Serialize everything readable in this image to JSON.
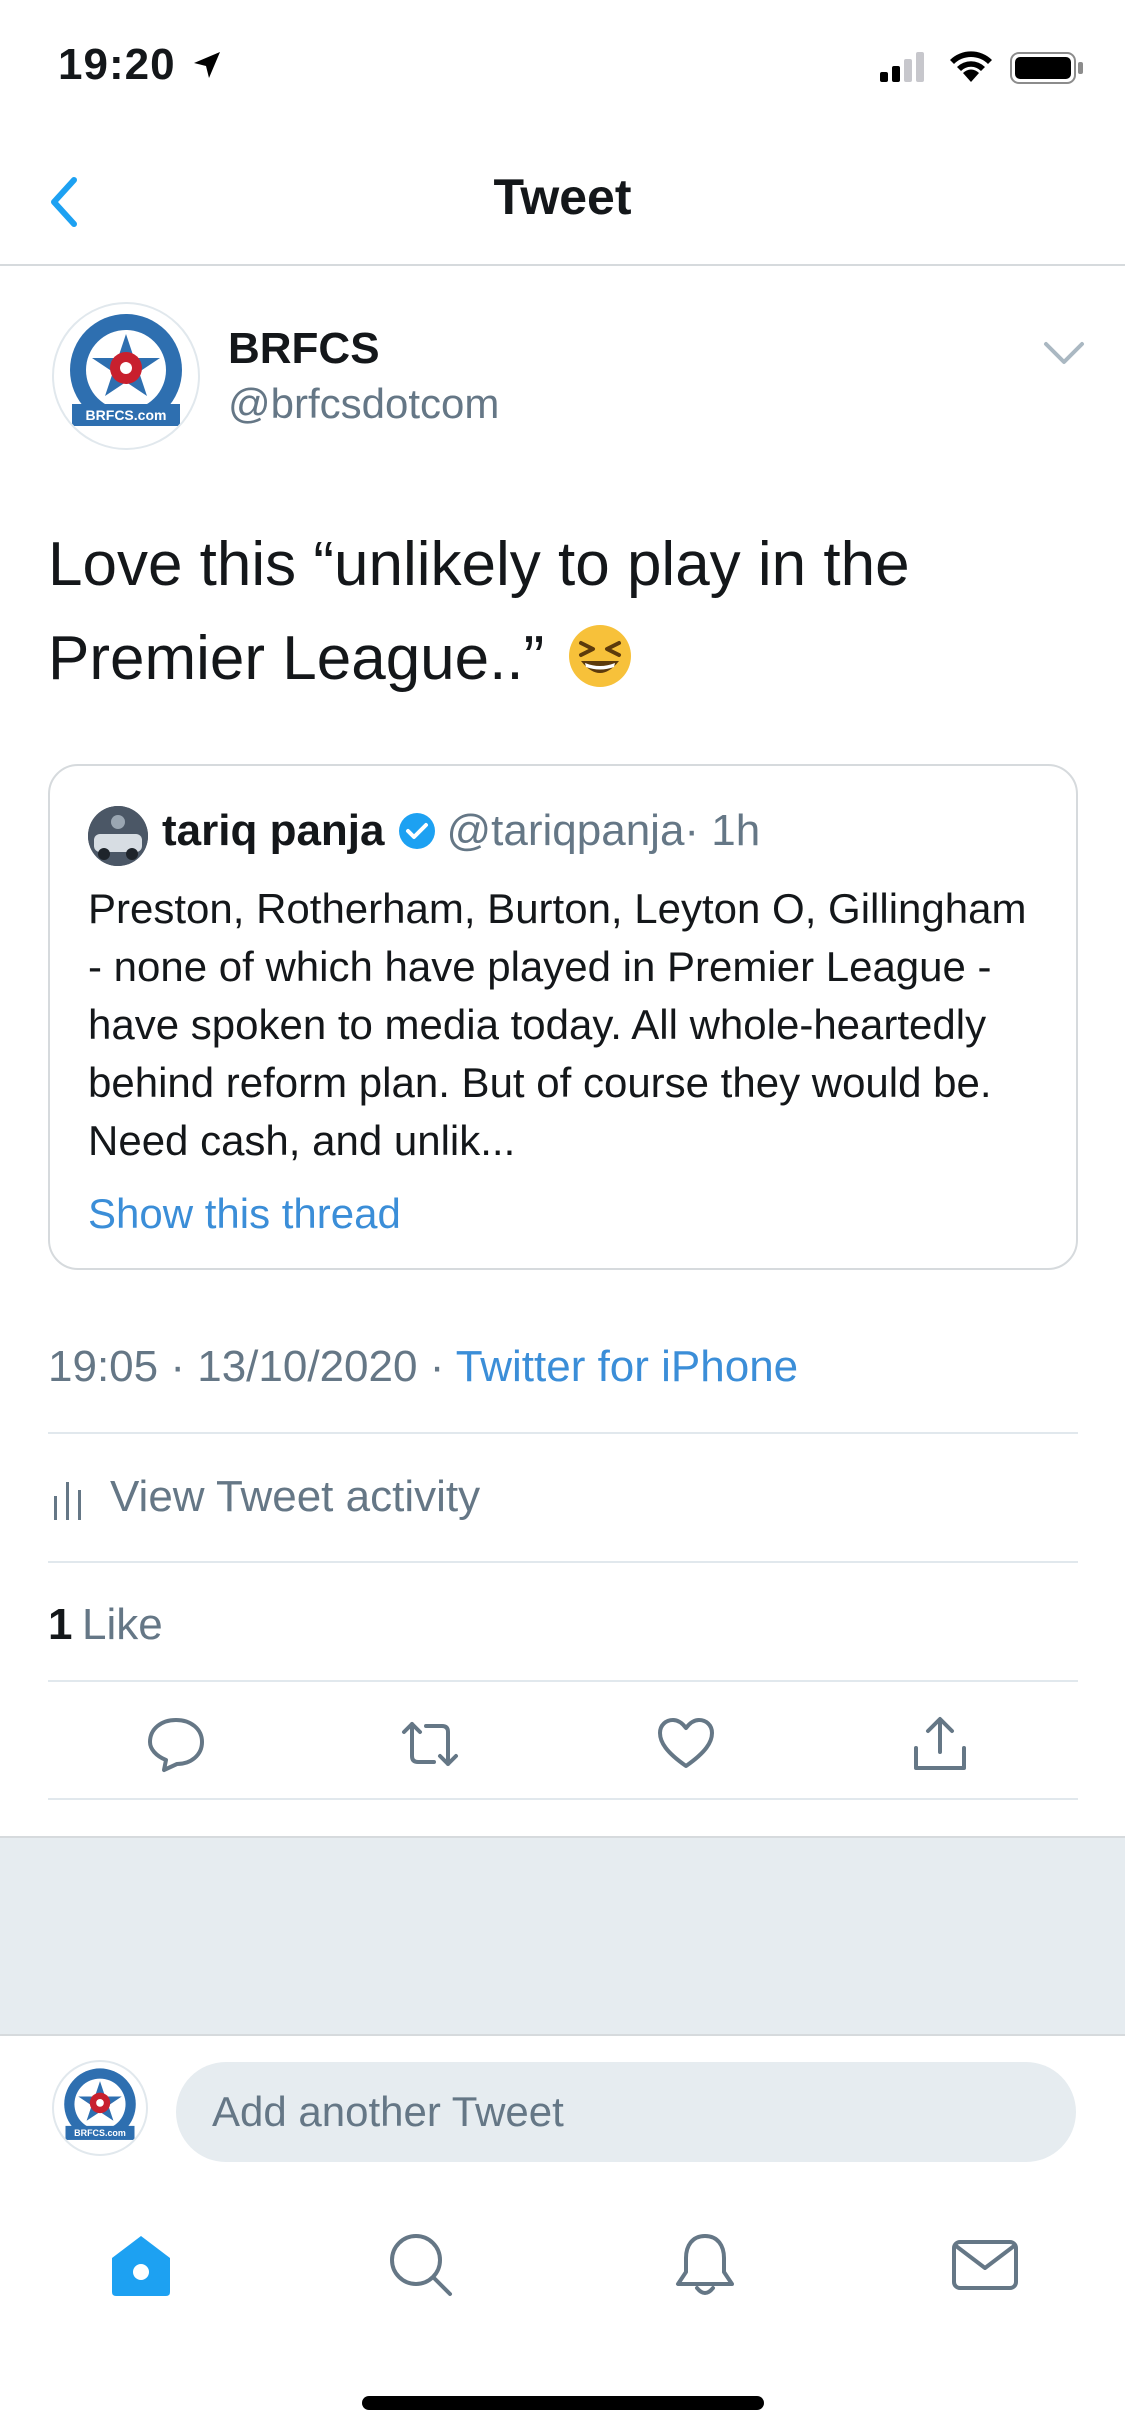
{
  "status_bar": {
    "time": "19:20",
    "location_icon": "location-arrow-icon",
    "signal_icon": "cellular-signal-icon",
    "wifi_icon": "wifi-icon",
    "battery_icon": "battery-icon"
  },
  "nav": {
    "title": "Tweet",
    "back_icon": "chevron-left-icon"
  },
  "author": {
    "name": "BRFCS",
    "handle": "@brfcsdotcom",
    "avatar_label": "BRFCS.com"
  },
  "tweet": {
    "text": "Love this “unlikely to play in the Premier League..”",
    "emoji": "grinning-squinting-face-emoji"
  },
  "quote": {
    "name": "tariq panja",
    "handle": "@tariqpanja",
    "time": "· 1h",
    "text": "Preston, Rotherham, Burton, Leyton O, Gillingham - none of which have played in Premier League - have spoken to media today. All whole-heartedly behind reform plan. But of course they would be. Need cash, and unlik...",
    "show_thread": "Show this thread"
  },
  "meta": {
    "time": "19:05",
    "date": "13/10/2020",
    "separator": "·",
    "source": "Twitter for iPhone"
  },
  "activity": {
    "label": "View Tweet activity"
  },
  "likes": {
    "count": "1",
    "label": "Like"
  },
  "actions": {
    "reply_icon": "reply-icon",
    "retweet_icon": "retweet-icon",
    "like_icon": "heart-icon",
    "share_icon": "share-icon"
  },
  "reply": {
    "placeholder": "Add another Tweet"
  },
  "tabs": [
    {
      "icon": "home-icon",
      "active": true
    },
    {
      "icon": "search-icon",
      "active": false
    },
    {
      "icon": "bell-icon",
      "active": false
    },
    {
      "icon": "mail-icon",
      "active": false
    }
  ],
  "colors": {
    "accent": "#1da1f2",
    "link": "#3b8ed8",
    "secondary_text": "#657786",
    "divider": "#e1e8ed",
    "gray_background": "#e6ecf0"
  }
}
